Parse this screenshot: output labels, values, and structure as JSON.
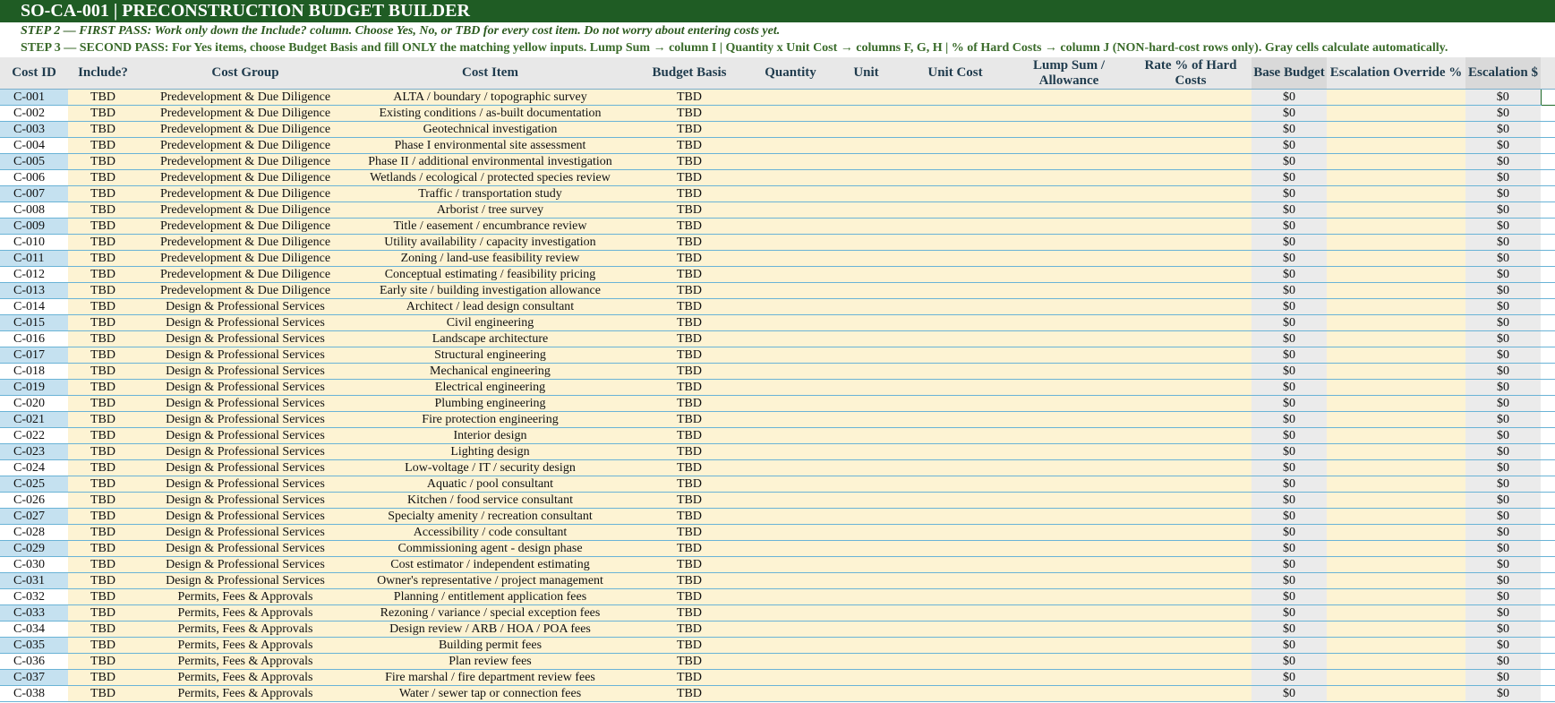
{
  "sheet": {
    "title": "SO-CA-001 | PRECONSTRUCTION BUDGET BUILDER",
    "step2": "STEP 2 — FIRST PASS: Work only down the Include? column. Choose Yes, No, or TBD for every cost item. Do not worry about entering costs yet.",
    "step3": "STEP 3 — SECOND PASS: For Yes items, choose Budget Basis and fill ONLY the matching yellow inputs. Lump Sum → column I | Quantity x Unit Cost → columns F, G, H | % of Hard Costs → column J (NON-hard-cost rows only). Gray cells calculate automatically."
  },
  "headers": {
    "cost_id": "Cost ID",
    "include": "Include?",
    "cost_group": "Cost Group",
    "cost_item": "Cost Item",
    "budget_basis": "Budget Basis",
    "quantity": "Quantity",
    "unit": "Unit",
    "unit_cost": "Unit Cost",
    "lump_sum": "Lump Sum / Allowance",
    "rate": "Rate % of Hard Costs",
    "base_budget": "Base Budget",
    "escalation_override": "Escalation Override %",
    "escalation_dollars": "Escalation $"
  },
  "rows": [
    {
      "id": "C-001",
      "include": "TBD",
      "group": "Predevelopment & Due Diligence",
      "item": "ALTA / boundary / topographic survey",
      "basis": "TBD",
      "base": "$0",
      "esc": "$0"
    },
    {
      "id": "C-002",
      "include": "TBD",
      "group": "Predevelopment & Due Diligence",
      "item": "Existing conditions / as-built documentation",
      "basis": "TBD",
      "base": "$0",
      "esc": "$0"
    },
    {
      "id": "C-003",
      "include": "TBD",
      "group": "Predevelopment & Due Diligence",
      "item": "Geotechnical investigation",
      "basis": "TBD",
      "base": "$0",
      "esc": "$0"
    },
    {
      "id": "C-004",
      "include": "TBD",
      "group": "Predevelopment & Due Diligence",
      "item": "Phase I environmental site assessment",
      "basis": "TBD",
      "base": "$0",
      "esc": "$0"
    },
    {
      "id": "C-005",
      "include": "TBD",
      "group": "Predevelopment & Due Diligence",
      "item": "Phase II / additional environmental investigation",
      "basis": "TBD",
      "base": "$0",
      "esc": "$0"
    },
    {
      "id": "C-006",
      "include": "TBD",
      "group": "Predevelopment & Due Diligence",
      "item": "Wetlands / ecological / protected species review",
      "basis": "TBD",
      "base": "$0",
      "esc": "$0"
    },
    {
      "id": "C-007",
      "include": "TBD",
      "group": "Predevelopment & Due Diligence",
      "item": "Traffic / transportation study",
      "basis": "TBD",
      "base": "$0",
      "esc": "$0"
    },
    {
      "id": "C-008",
      "include": "TBD",
      "group": "Predevelopment & Due Diligence",
      "item": "Arborist / tree survey",
      "basis": "TBD",
      "base": "$0",
      "esc": "$0"
    },
    {
      "id": "C-009",
      "include": "TBD",
      "group": "Predevelopment & Due Diligence",
      "item": "Title / easement / encumbrance review",
      "basis": "TBD",
      "base": "$0",
      "esc": "$0"
    },
    {
      "id": "C-010",
      "include": "TBD",
      "group": "Predevelopment & Due Diligence",
      "item": "Utility availability / capacity investigation",
      "basis": "TBD",
      "base": "$0",
      "esc": "$0"
    },
    {
      "id": "C-011",
      "include": "TBD",
      "group": "Predevelopment & Due Diligence",
      "item": "Zoning / land-use feasibility review",
      "basis": "TBD",
      "base": "$0",
      "esc": "$0"
    },
    {
      "id": "C-012",
      "include": "TBD",
      "group": "Predevelopment & Due Diligence",
      "item": "Conceptual estimating / feasibility pricing",
      "basis": "TBD",
      "base": "$0",
      "esc": "$0"
    },
    {
      "id": "C-013",
      "include": "TBD",
      "group": "Predevelopment & Due Diligence",
      "item": "Early site / building investigation allowance",
      "basis": "TBD",
      "base": "$0",
      "esc": "$0"
    },
    {
      "id": "C-014",
      "include": "TBD",
      "group": "Design & Professional Services",
      "item": "Architect / lead design consultant",
      "basis": "TBD",
      "base": "$0",
      "esc": "$0"
    },
    {
      "id": "C-015",
      "include": "TBD",
      "group": "Design & Professional Services",
      "item": "Civil engineering",
      "basis": "TBD",
      "base": "$0",
      "esc": "$0"
    },
    {
      "id": "C-016",
      "include": "TBD",
      "group": "Design & Professional Services",
      "item": "Landscape architecture",
      "basis": "TBD",
      "base": "$0",
      "esc": "$0"
    },
    {
      "id": "C-017",
      "include": "TBD",
      "group": "Design & Professional Services",
      "item": "Structural engineering",
      "basis": "TBD",
      "base": "$0",
      "esc": "$0"
    },
    {
      "id": "C-018",
      "include": "TBD",
      "group": "Design & Professional Services",
      "item": "Mechanical engineering",
      "basis": "TBD",
      "base": "$0",
      "esc": "$0"
    },
    {
      "id": "C-019",
      "include": "TBD",
      "group": "Design & Professional Services",
      "item": "Electrical engineering",
      "basis": "TBD",
      "base": "$0",
      "esc": "$0"
    },
    {
      "id": "C-020",
      "include": "TBD",
      "group": "Design & Professional Services",
      "item": "Plumbing engineering",
      "basis": "TBD",
      "base": "$0",
      "esc": "$0"
    },
    {
      "id": "C-021",
      "include": "TBD",
      "group": "Design & Professional Services",
      "item": "Fire protection engineering",
      "basis": "TBD",
      "base": "$0",
      "esc": "$0"
    },
    {
      "id": "C-022",
      "include": "TBD",
      "group": "Design & Professional Services",
      "item": "Interior design",
      "basis": "TBD",
      "base": "$0",
      "esc": "$0"
    },
    {
      "id": "C-023",
      "include": "TBD",
      "group": "Design & Professional Services",
      "item": "Lighting design",
      "basis": "TBD",
      "base": "$0",
      "esc": "$0"
    },
    {
      "id": "C-024",
      "include": "TBD",
      "group": "Design & Professional Services",
      "item": "Low-voltage / IT / security design",
      "basis": "TBD",
      "base": "$0",
      "esc": "$0"
    },
    {
      "id": "C-025",
      "include": "TBD",
      "group": "Design & Professional Services",
      "item": "Aquatic / pool consultant",
      "basis": "TBD",
      "base": "$0",
      "esc": "$0"
    },
    {
      "id": "C-026",
      "include": "TBD",
      "group": "Design & Professional Services",
      "item": "Kitchen / food service consultant",
      "basis": "TBD",
      "base": "$0",
      "esc": "$0"
    },
    {
      "id": "C-027",
      "include": "TBD",
      "group": "Design & Professional Services",
      "item": "Specialty amenity / recreation consultant",
      "basis": "TBD",
      "base": "$0",
      "esc": "$0"
    },
    {
      "id": "C-028",
      "include": "TBD",
      "group": "Design & Professional Services",
      "item": "Accessibility / code consultant",
      "basis": "TBD",
      "base": "$0",
      "esc": "$0"
    },
    {
      "id": "C-029",
      "include": "TBD",
      "group": "Design & Professional Services",
      "item": "Commissioning agent - design phase",
      "basis": "TBD",
      "base": "$0",
      "esc": "$0"
    },
    {
      "id": "C-030",
      "include": "TBD",
      "group": "Design & Professional Services",
      "item": "Cost estimator / independent estimating",
      "basis": "TBD",
      "base": "$0",
      "esc": "$0"
    },
    {
      "id": "C-031",
      "include": "TBD",
      "group": "Design & Professional Services",
      "item": "Owner's representative / project management",
      "basis": "TBD",
      "base": "$0",
      "esc": "$0"
    },
    {
      "id": "C-032",
      "include": "TBD",
      "group": "Permits, Fees & Approvals",
      "item": "Planning / entitlement application fees",
      "basis": "TBD",
      "base": "$0",
      "esc": "$0"
    },
    {
      "id": "C-033",
      "include": "TBD",
      "group": "Permits, Fees & Approvals",
      "item": "Rezoning / variance / special exception fees",
      "basis": "TBD",
      "base": "$0",
      "esc": "$0"
    },
    {
      "id": "C-034",
      "include": "TBD",
      "group": "Permits, Fees & Approvals",
      "item": "Design review / ARB / HOA / POA fees",
      "basis": "TBD",
      "base": "$0",
      "esc": "$0"
    },
    {
      "id": "C-035",
      "include": "TBD",
      "group": "Permits, Fees & Approvals",
      "item": "Building permit fees",
      "basis": "TBD",
      "base": "$0",
      "esc": "$0"
    },
    {
      "id": "C-036",
      "include": "TBD",
      "group": "Permits, Fees & Approvals",
      "item": "Plan review fees",
      "basis": "TBD",
      "base": "$0",
      "esc": "$0"
    },
    {
      "id": "C-037",
      "include": "TBD",
      "group": "Permits, Fees & Approvals",
      "item": "Fire marshal / fire department review fees",
      "basis": "TBD",
      "base": "$0",
      "esc": "$0"
    },
    {
      "id": "C-038",
      "include": "TBD",
      "group": "Permits, Fees & Approvals",
      "item": "Water / sewer tap or connection fees",
      "basis": "TBD",
      "base": "$0",
      "esc": "$0"
    }
  ]
}
